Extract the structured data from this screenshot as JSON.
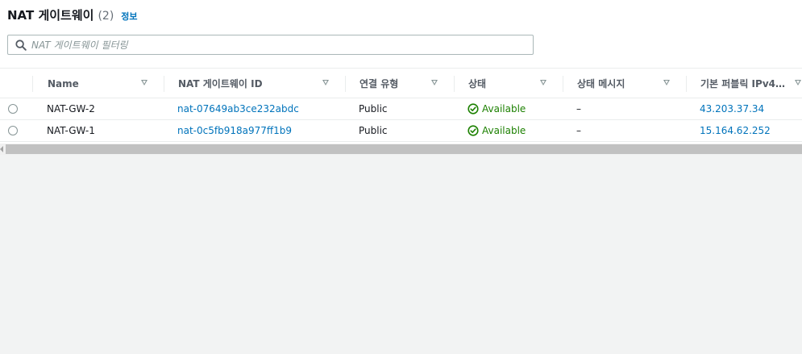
{
  "header": {
    "title": "NAT 게이트웨이",
    "count": "(2)",
    "info_link": "정보"
  },
  "search": {
    "placeholder": "NAT 게이트웨이 필터링",
    "value": ""
  },
  "table": {
    "columns": [
      {
        "key": "name",
        "label": "Name"
      },
      {
        "key": "id",
        "label": "NAT 게이트웨이 ID"
      },
      {
        "key": "conn",
        "label": "연결 유형"
      },
      {
        "key": "state",
        "label": "상태"
      },
      {
        "key": "state_msg",
        "label": "상태 메시지"
      },
      {
        "key": "ipv4",
        "label": "기본 퍼블릭 IPv4…"
      }
    ],
    "rows": [
      {
        "name": "NAT-GW-2",
        "id": "nat-07649ab3ce232abdc",
        "conn": "Public",
        "state": "Available",
        "state_msg": "–",
        "ipv4": "43.203.37.34"
      },
      {
        "name": "NAT-GW-1",
        "id": "nat-0c5fb918a977ff1b9",
        "conn": "Public",
        "state": "Available",
        "state_msg": "–",
        "ipv4": "15.164.62.252"
      }
    ]
  },
  "colors": {
    "link": "#0073bb",
    "success": "#1d8102",
    "header_text": "#545b64"
  }
}
